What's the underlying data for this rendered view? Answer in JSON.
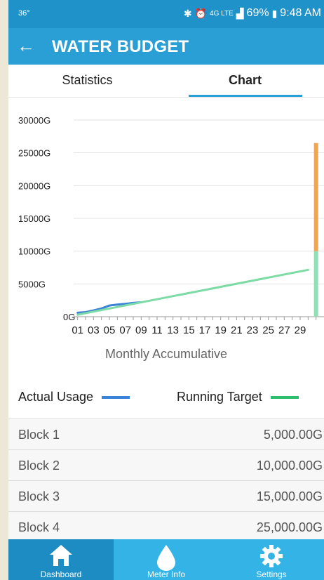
{
  "status_bar": {
    "temperature": "36°",
    "signal_label": "4G LTE",
    "battery": "69%",
    "time": "9:48 AM"
  },
  "app_bar": {
    "title": "WATER BUDGET"
  },
  "tabs": [
    {
      "label": "Statistics",
      "selected": false
    },
    {
      "label": "Chart",
      "selected": true
    }
  ],
  "chart_data": {
    "type": "line",
    "title": "",
    "xlabel": "Monthly Accumulative",
    "ylabel": "",
    "ylim": [
      0,
      30000
    ],
    "y_ticks": [
      "0G",
      "5000G",
      "10000G",
      "15000G",
      "20000G",
      "25000G",
      "30000G"
    ],
    "x_ticks": [
      "01",
      "03",
      "05",
      "07",
      "09",
      "11",
      "13",
      "15",
      "17",
      "19",
      "21",
      "23",
      "25",
      "27",
      "29"
    ],
    "series": [
      {
        "name": "Actual Usage",
        "color": "#3b82d9",
        "x": [
          1,
          2,
          3,
          4,
          5,
          6,
          7,
          8,
          9
        ],
        "y": [
          600,
          700,
          950,
          1250,
          1700,
          1850,
          1950,
          2100,
          2200
        ]
      },
      {
        "name": "Running Target",
        "color": "#7ddba6",
        "x": [
          1,
          30
        ],
        "y": [
          300,
          7150
        ]
      }
    ],
    "stacked_bar": {
      "x": 31,
      "segments": [
        {
          "value": 10000,
          "color": "#8fe0b4"
        },
        {
          "value": 16500,
          "color": "#f0a555"
        }
      ]
    },
    "grid": true,
    "legend_position": "bottom"
  },
  "legend": {
    "actual_label": "Actual Usage",
    "actual_color": "#3b82d9",
    "target_label": "Running Target",
    "target_color": "#2ebd6b"
  },
  "blocks": [
    {
      "name": "Block 1",
      "amount": "5,000.00G"
    },
    {
      "name": "Block 2",
      "amount": "10,000.00G"
    },
    {
      "name": "Block 3",
      "amount": "15,000.00G"
    },
    {
      "name": "Block 4",
      "amount": "25,000.00G"
    }
  ],
  "bottom_nav": [
    {
      "label": "Dashboard",
      "icon": "home-icon",
      "active": true
    },
    {
      "label": "Meter Info",
      "icon": "water-drop-icon",
      "active": false
    },
    {
      "label": "Settings",
      "icon": "gear-icon",
      "active": false
    }
  ]
}
